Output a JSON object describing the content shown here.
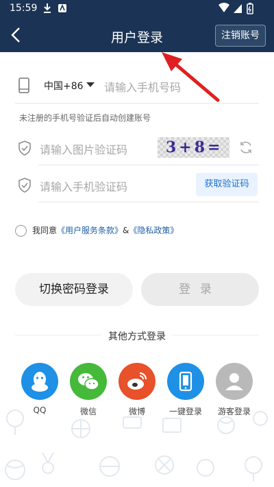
{
  "status": {
    "time": "15:59"
  },
  "header": {
    "title": "用户登录",
    "cancel_label": "注销账号"
  },
  "phone": {
    "country_code": "中国+86",
    "placeholder": "请输入手机号码",
    "hint": "未注册的手机号验证后自动创建账号"
  },
  "captcha": {
    "placeholder": "请输入图片验证码",
    "image_text": "3+8="
  },
  "sms": {
    "placeholder": "请输入手机验证码",
    "get_code_label": "获取验证码"
  },
  "agreement": {
    "prefix": "我同意",
    "terms": "《用户服务条款》",
    "and": "&",
    "privacy": "《隐私政策》"
  },
  "buttons": {
    "switch_label": "切换密码登录",
    "login_label": "登录"
  },
  "other_login": {
    "title": "其他方式登录",
    "items": [
      {
        "label": "QQ",
        "color": "#1e90e6",
        "icon": "qq-icon"
      },
      {
        "label": "微信",
        "color": "#45b93a",
        "icon": "wechat-icon"
      },
      {
        "label": "微博",
        "color": "#e8512a",
        "icon": "weibo-icon"
      },
      {
        "label": "一键登录",
        "color": "#1e90e6",
        "icon": "phone-icon"
      },
      {
        "label": "游客登录",
        "color": "#b9b9b9",
        "icon": "user-icon"
      }
    ]
  },
  "colors": {
    "header_bg": "#1b3455",
    "accent": "#1f6fc9",
    "arrow": "#e02020"
  }
}
